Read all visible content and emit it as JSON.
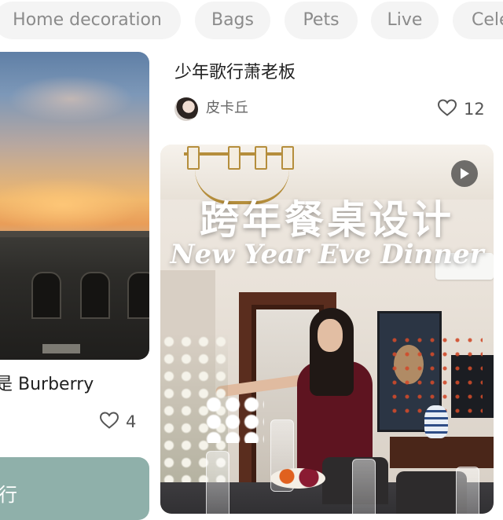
{
  "categories": [
    {
      "label": "Home decoration"
    },
    {
      "label": "Bags"
    },
    {
      "label": "Pets"
    },
    {
      "label": "Live"
    },
    {
      "label": "Cele"
    }
  ],
  "feed": {
    "left": {
      "caption": "还是 Burberry",
      "likes": "4",
      "next_card_text": "行"
    },
    "right": {
      "title": "少年歌行萧老板",
      "author": "皮卡丘",
      "likes": "12",
      "video": {
        "overlay_title_cn": "跨年餐桌设计",
        "overlay_title_en": "New Year Eve Dinner",
        "play_icon": "play-icon"
      }
    }
  },
  "colors": {
    "chip_bg": "#f4f4f4",
    "chip_text": "#8b8b8b",
    "text_primary": "#222222",
    "text_secondary": "#666666"
  }
}
